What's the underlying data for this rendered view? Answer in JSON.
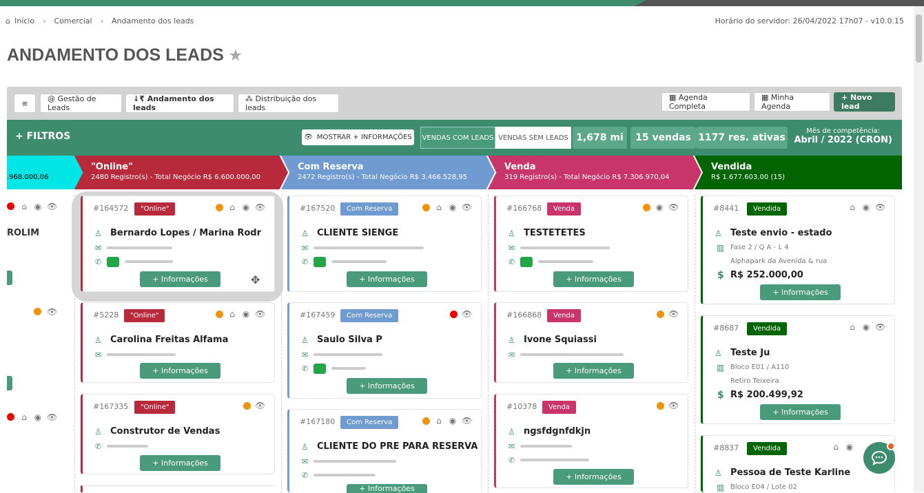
{
  "breadcrumb": {
    "home": "Início",
    "section": "Comercial",
    "page": "Andamento dos leads"
  },
  "server_time": "Horário do servidor: 26/04/2022 17h07 - v10.0.15",
  "title": "ANDAMENTO DOS LEADS",
  "toolbar": {
    "menu": "≡",
    "gestao": "@ Gestão de Leads",
    "andamento": "↓₹ Andamento dos leads",
    "distribuicao": "⁂ Distribuição dos leads",
    "agenda_completa": "▦ Agenda Completa",
    "minha_agenda": "▦ Minha Agenda",
    "novo_lead": "+ Novo lead"
  },
  "filters": {
    "label": "+ FILTROS",
    "show_more": "MOSTRAR + INFORMAÇÕES",
    "tab_with": "VENDAS COM LEADS",
    "tab_without": "VENDAS SEM LEADS",
    "stat1": "1,678 mi",
    "stat2": "15 vendas",
    "stat3": "1177 res. ativas",
    "month_label": "Mês de competência:",
    "month_value": "Abril / 2022 (CRON)"
  },
  "stages": [
    {
      "name": "",
      "count": ".968.000,06"
    },
    {
      "name": "\"Online\"",
      "count": "2480 Registro(s) - Total Negócio R$ 6.600.000,00"
    },
    {
      "name": "Com Reserva",
      "count": "2472 Registro(s) - Total Negócio R$ 3.466.528,95"
    },
    {
      "name": "Venda",
      "count": "319 Registro(s) - Total Negócio R$ 7.306.970,04"
    },
    {
      "name": "Vendida",
      "count": "R$ 1.677.603,00 (15)"
    }
  ],
  "partial_col": {
    "name": "ROLIM"
  },
  "cards": {
    "online": [
      {
        "id": "#164572",
        "badge": "\"Online\"",
        "name": "Bernardo Lopes / Marina Rodri…"
      },
      {
        "id": "#5228",
        "badge": "\"Online\"",
        "name": "Carolina Freitas Alfama"
      },
      {
        "id": "#167335",
        "badge": "\"Online\"",
        "name": "Construtor de Vendas"
      }
    ],
    "reserva": [
      {
        "id": "#167520",
        "badge": "Com Reserva",
        "name": "CLIENTE SIENGE"
      },
      {
        "id": "#167459",
        "badge": "Com Reserva",
        "name": "Saulo Silva P"
      },
      {
        "id": "#167180",
        "badge": "Com Reserva",
        "name": "CLIENTE DO PRE PARA RESERVA"
      }
    ],
    "venda": [
      {
        "id": "#166768",
        "badge": "Venda",
        "name": "TESTETETES"
      },
      {
        "id": "#166868",
        "badge": "Venda",
        "name": "Ivone Squiassi"
      },
      {
        "id": "#10378",
        "badge": "Venda",
        "name": "ngsfdgnfdkjn"
      }
    ],
    "vendida": [
      {
        "id": "#8441",
        "badge": "Vendida",
        "name": "Teste envio - estado",
        "unit": "Fase 2 / Q A - L 4",
        "project": "Alphapark da Avenida & rua",
        "price": "R$ 252.000,00"
      },
      {
        "id": "#8687",
        "badge": "Vendida",
        "name": "Teste Ju",
        "unit": "Bloco E01 / A110",
        "project": "Retiro Teixeira",
        "price": "R$ 200.499,92"
      },
      {
        "id": "#8837",
        "badge": "Vendida",
        "name": "Pessoa de Teste Karline",
        "unit": "Bloco E04 / Lote 02"
      }
    ]
  },
  "info_button": "+ Informações",
  "colors": {
    "green": "#3d8c6e",
    "online": "#b8293b",
    "reserva": "#6f9bd1",
    "venda": "#c9356b",
    "vendida": "#006400",
    "cyan": "#00e5e5"
  }
}
